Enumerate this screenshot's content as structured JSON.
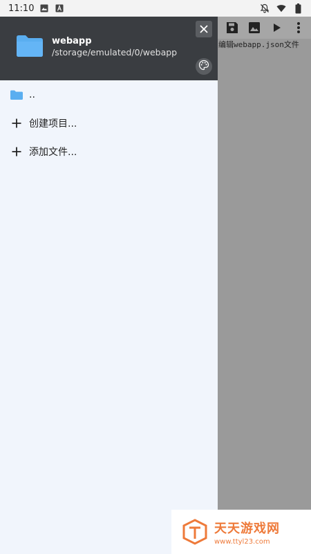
{
  "status_bar": {
    "time": "11:10",
    "left_icons": [
      "image-icon",
      "a-icon"
    ],
    "right_icons": [
      "bell-off-icon",
      "wifi-icon",
      "battery-icon"
    ]
  },
  "editor": {
    "toolbar_icons": [
      "save-icon",
      "image-icon",
      "play-icon",
      "more-vert-icon"
    ],
    "filename_hint": "编辑webapp.json文件"
  },
  "drawer": {
    "header": {
      "title": "webapp",
      "path": "/storage/emulated/0/webapp"
    },
    "items": [
      {
        "icon": "folder-icon",
        "label": ".."
      },
      {
        "icon": "plus-icon",
        "label": "创建项目..."
      },
      {
        "icon": "plus-icon",
        "label": "添加文件..."
      }
    ]
  },
  "watermark": {
    "brand": "天天游戏网",
    "url": "www.ttyl23.com"
  },
  "colors": {
    "drawer_header_bg": "#3a3d41",
    "drawer_bg": "#f1f5fc",
    "folder_blue": "#5aaef0",
    "watermark_orange": "#ee7a3a"
  }
}
